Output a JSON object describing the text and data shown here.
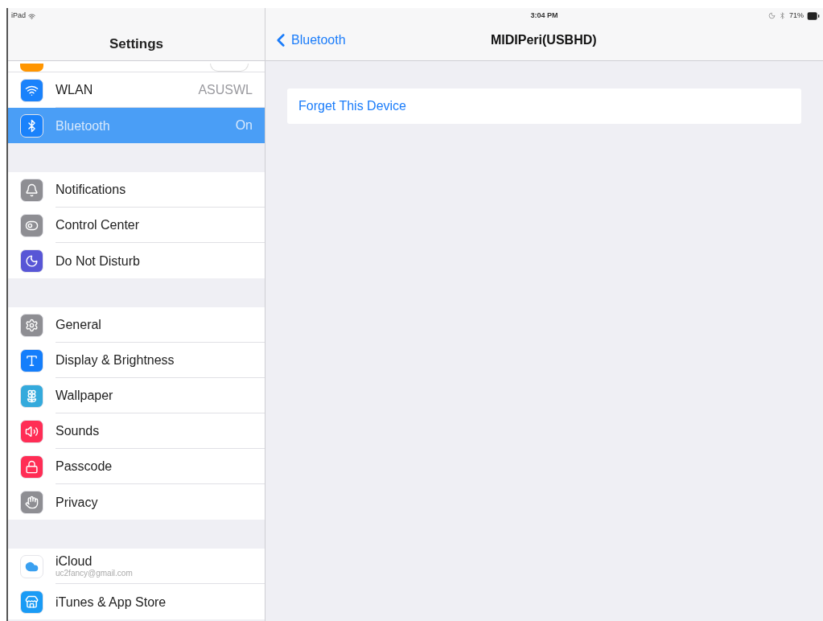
{
  "status_bar": {
    "carrier": "iPad",
    "time": "3:04 PM",
    "battery": "71%"
  },
  "sidebar": {
    "title": "Settings",
    "partial_row": {
      "color": "#ff9500",
      "on": false
    },
    "groups": [
      [
        {
          "label": "WLAN",
          "value": "ASUSWL",
          "color": "#1a82fb",
          "selected": false
        },
        {
          "label": "Bluetooth",
          "value": "On",
          "color": "#1a82fb",
          "selected": true
        }
      ],
      [
        {
          "label": "Notifications",
          "color": "#8e8e93",
          "selected": false
        },
        {
          "label": "Control Center",
          "color": "#8e8e93",
          "selected": false
        },
        {
          "label": "Do Not Disturb",
          "color": "#5856d6",
          "selected": false
        }
      ],
      [
        {
          "label": "General",
          "color": "#8e8e93",
          "selected": false
        },
        {
          "label": "Display & Brightness",
          "color": "#147efb",
          "selected": false
        },
        {
          "label": "Wallpaper",
          "color": "#34aadc",
          "selected": false
        },
        {
          "label": "Sounds",
          "color": "#ff2d55",
          "selected": false
        },
        {
          "label": "Passcode",
          "color": "#ff2d55",
          "selected": false
        },
        {
          "label": "Privacy",
          "color": "#8e8e93",
          "selected": false
        }
      ],
      [
        {
          "label": "iCloud",
          "subtitle": "uc2fancy@gmail.com",
          "color": "#ffffff",
          "selected": false
        },
        {
          "label": "iTunes & App Store",
          "color": "#1a9bf5",
          "selected": false
        }
      ]
    ]
  },
  "detail": {
    "back": "Bluetooth",
    "title": "MIDIPeri(USBHD)",
    "action": "Forget This Device"
  }
}
